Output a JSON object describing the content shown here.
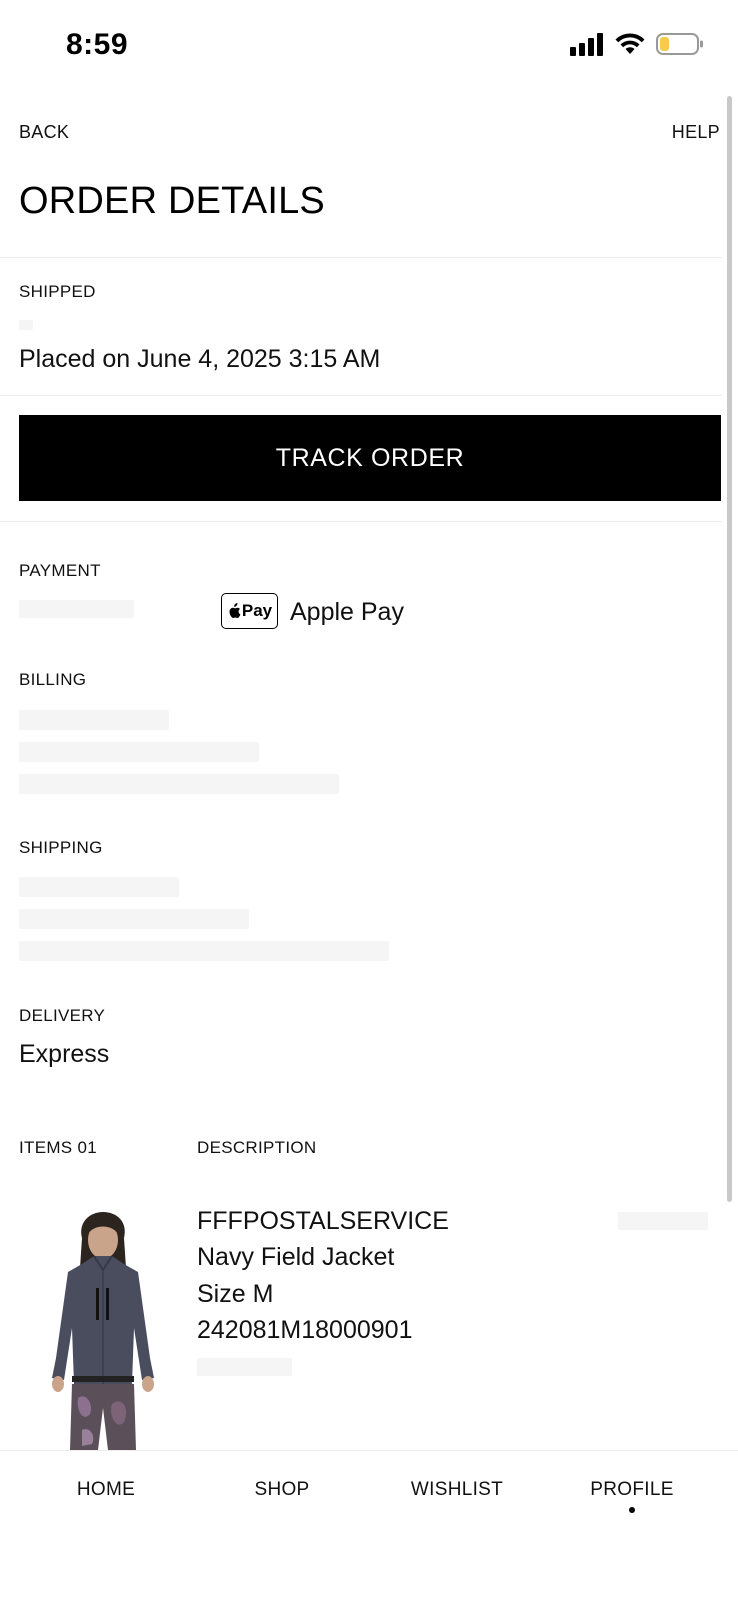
{
  "status_bar": {
    "time": "8:59"
  },
  "header": {
    "back_label": "BACK",
    "help_label": "HELP",
    "title": "ORDER DETAILS"
  },
  "order": {
    "status": "SHIPPED",
    "placed_on": "Placed on June 4, 2025 3:15 AM"
  },
  "track_button_label": "TRACK ORDER",
  "payment": {
    "label": "PAYMENT",
    "badge_text": "Pay",
    "method": "Apple Pay"
  },
  "billing": {
    "label": "BILLING"
  },
  "shipping": {
    "label": "SHIPPING"
  },
  "delivery": {
    "label": "DELIVERY",
    "value": "Express"
  },
  "items": {
    "count_label": "ITEMS 01",
    "description_label": "DESCRIPTION",
    "list": [
      {
        "brand": "FFFPOSTALSERVICE",
        "name": "Navy Field Jacket",
        "size": "Size M",
        "sku": "242081M18000901"
      }
    ]
  },
  "bottom_nav": {
    "items": [
      {
        "label": "HOME"
      },
      {
        "label": "SHOP"
      },
      {
        "label": "WISHLIST"
      },
      {
        "label": "PROFILE",
        "active": true
      }
    ]
  },
  "colors": {
    "primary": "#000000",
    "background": "#ffffff",
    "divider": "#ececec",
    "battery_level": "#f5cc4a"
  }
}
